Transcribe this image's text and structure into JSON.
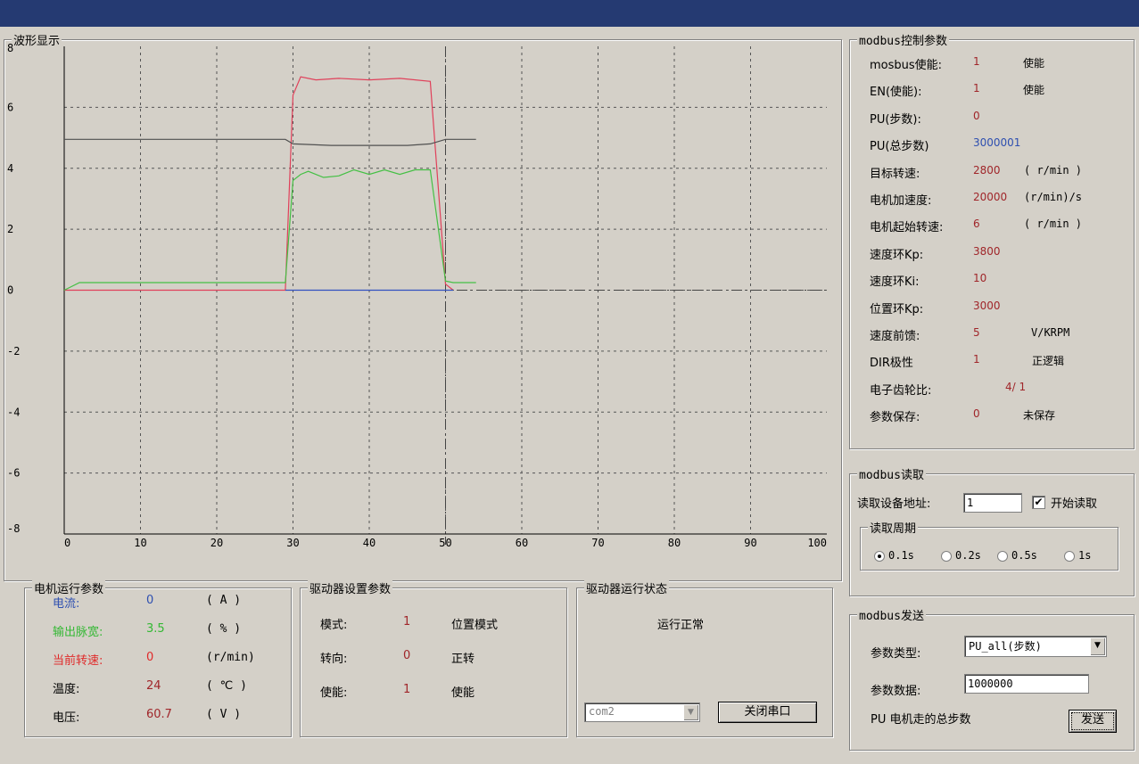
{
  "waveform": {
    "title": "波形显示",
    "chart_data": {
      "type": "line",
      "xlim": [
        0,
        100
      ],
      "ylim": [
        -8,
        8
      ],
      "x_ticks": [
        0,
        10,
        20,
        30,
        40,
        50,
        60,
        70,
        80,
        90,
        100
      ],
      "y_ticks": [
        8,
        6,
        4,
        2,
        0,
        -2,
        -4,
        -6,
        -8
      ],
      "grid": true,
      "series": [
        {
          "color": "#e0405a",
          "points": [
            [
              0,
              0
            ],
            [
              29,
              0
            ],
            [
              30,
              6.4
            ],
            [
              31,
              7
            ],
            [
              33,
              6.9
            ],
            [
              36,
              6.95
            ],
            [
              40,
              6.9
            ],
            [
              44,
              6.95
            ],
            [
              48,
              6.85
            ],
            [
              50,
              0.2
            ],
            [
              51,
              0
            ]
          ]
        },
        {
          "color": "#505050",
          "points": [
            [
              0,
              4.95
            ],
            [
              29,
              4.95
            ],
            [
              30,
              4.8
            ],
            [
              35,
              4.75
            ],
            [
              40,
              4.75
            ],
            [
              45,
              4.75
            ],
            [
              48,
              4.8
            ],
            [
              50,
              4.95
            ],
            [
              54,
              4.95
            ]
          ]
        },
        {
          "color": "#44c044",
          "points": [
            [
              0,
              0
            ],
            [
              2,
              0.25
            ],
            [
              29,
              0.25
            ],
            [
              30,
              3.6
            ],
            [
              31,
              3.8
            ],
            [
              32,
              3.9
            ],
            [
              34,
              3.7
            ],
            [
              36,
              3.75
            ],
            [
              38,
              3.95
            ],
            [
              40,
              3.8
            ],
            [
              42,
              3.95
            ],
            [
              44,
              3.8
            ],
            [
              46,
              3.95
            ],
            [
              48,
              3.95
            ],
            [
              50,
              0.3
            ],
            [
              51,
              0.25
            ],
            [
              54,
              0.25
            ]
          ]
        },
        {
          "color": "#3050c0",
          "points": [
            [
              29,
              0
            ],
            [
              51,
              0
            ]
          ]
        }
      ],
      "cursor_x": 50
    }
  },
  "motor": {
    "title": "电机运行参数",
    "rows": [
      {
        "label": "电流:",
        "value": "0",
        "unit": "( A )"
      },
      {
        "label": "输出脉宽:",
        "value": "3.5",
        "unit": "( % )"
      },
      {
        "label": "当前转速:",
        "value": "0",
        "unit": "(r/min)"
      },
      {
        "label": "温度:",
        "value": "24",
        "unit": "( ℃ )"
      },
      {
        "label": "电压:",
        "value": "60.7",
        "unit": "( V )"
      }
    ]
  },
  "driver_settings": {
    "title": "驱动器设置参数",
    "rows": [
      {
        "label": "模式:",
        "value": "1",
        "desc": "位置模式"
      },
      {
        "label": "转向:",
        "value": "0",
        "desc": "正转"
      },
      {
        "label": "使能:",
        "value": "1",
        "desc": "使能"
      }
    ]
  },
  "driver_status": {
    "title": "驱动器运行状态",
    "status_text": "运行正常",
    "port_value": "com2",
    "close_port_label": "关闭串口"
  },
  "modbus_control": {
    "title": "modbus控制参数",
    "rows": [
      {
        "label": "mosbus使能:",
        "value": "1",
        "unit": "使能"
      },
      {
        "label": "EN(使能):",
        "value": "1",
        "unit": "使能"
      },
      {
        "label": "PU(步数):",
        "value": "0",
        "unit": ""
      },
      {
        "label": "PU(总步数)",
        "value": "3000001",
        "unit": ""
      },
      {
        "label": "目标转速:",
        "value": "2800",
        "unit": "( r/min )"
      },
      {
        "label": "电机加速度:",
        "value": "20000",
        "unit": "(r/min)/s"
      },
      {
        "label": "电机起始转速:",
        "value": "6",
        "unit": "( r/min )"
      },
      {
        "label": "速度环Kp:",
        "value": "3800",
        "unit": ""
      },
      {
        "label": "速度环Ki:",
        "value": "10",
        "unit": ""
      },
      {
        "label": "位置环Kp:",
        "value": "3000",
        "unit": ""
      },
      {
        "label": "速度前馈:",
        "value": "5",
        "unit": "V/KRPM"
      },
      {
        "label": "DIR极性",
        "value": "1",
        "unit": "正逻辑"
      },
      {
        "label": "电子齿轮比:",
        "value": "4/ 1",
        "unit": ""
      },
      {
        "label": "参数保存:",
        "value": "0",
        "unit": "未保存"
      }
    ]
  },
  "modbus_read": {
    "title": "modbus读取",
    "address_label": "读取设备地址:",
    "address_value": "1",
    "start_read_label": "开始读取",
    "start_read_checked": "✔",
    "period_title": "读取周期",
    "periods": [
      "0.1s",
      "0.2s",
      "0.5s",
      "1s"
    ],
    "selected_period": "0.1s"
  },
  "modbus_send": {
    "title": "modbus发送",
    "param_type_label": "参数类型:",
    "param_type_value": "PU_all(步数)",
    "param_data_label": "参数数据:",
    "param_data_value": "1000000",
    "hint": "PU 电机走的总步数",
    "send_label": "发送"
  }
}
